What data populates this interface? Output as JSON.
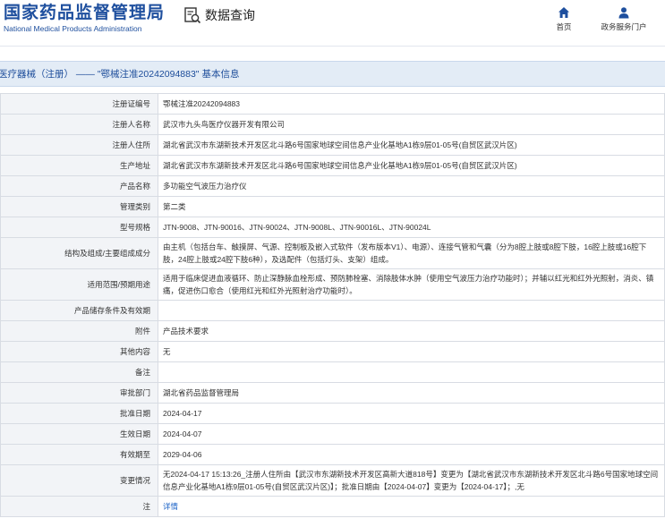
{
  "header": {
    "brand_cn": "国家药品监督管理局",
    "brand_en": "National Medical Products Administration",
    "search_title": "数据查询",
    "nav": [
      {
        "label": "首页",
        "icon": "home-icon"
      },
      {
        "label": "政务服务门户",
        "icon": "user-icon"
      }
    ]
  },
  "section": {
    "title": "医疗器械（注册） —— \"鄂械注准20242094883\" 基本信息"
  },
  "rows": [
    {
      "key": "注册证编号",
      "value": "鄂械注准20242094883"
    },
    {
      "key": "注册人名称",
      "value": "武汉市九头鸟医疗仪器开发有限公司"
    },
    {
      "key": "注册人住所",
      "value": "湖北省武汉市东湖新技术开发区北斗路6号国家地球空间信息产业化基地A1栋9层01-05号(自贸区武汉片区)"
    },
    {
      "key": "生产地址",
      "value": "湖北省武汉市东湖新技术开发区北斗路6号国家地球空间信息产业化基地A1栋9层01-05号(自贸区武汉片区)"
    },
    {
      "key": "产品名称",
      "value": "多功能空气波压力治疗仪"
    },
    {
      "key": "管理类别",
      "value": "第二类"
    },
    {
      "key": "型号规格",
      "value": "JTN-9008、JTN-90016、JTN-90024、JTN-9008L、JTN-90016L、JTN-90024L"
    },
    {
      "key": "结构及组成/主要组成成分",
      "value": "由主机（包括台车、触摸屏、气源、控制板及嵌入式软件（发布版本V1）、电源）、连接气管和气囊（分为8腔上肢或8腔下肢，16腔上肢或16腔下肢，24腔上肢或24腔下肢6种），及选配件（包括灯头、支架）组成。"
    },
    {
      "key": "适用范围/预期用途",
      "value": "适用于临床促进血液循环、防止深静脉血栓形成、预防肺栓塞、消除肢体水肿（使用空气波压力治疗功能时）；并辅以红光和红外光照射，消炎、镇痛，促进伤口愈合（使用红光和红外光照射治疗功能时）。"
    },
    {
      "key": "产品储存条件及有效期",
      "value": ""
    },
    {
      "key": "附件",
      "value": "产品技术要求"
    },
    {
      "key": "其他内容",
      "value": "无"
    },
    {
      "key": "备注",
      "value": ""
    },
    {
      "key": "审批部门",
      "value": "湖北省药品监督管理局"
    },
    {
      "key": "批准日期",
      "value": "2024-04-17"
    },
    {
      "key": "生效日期",
      "value": "2024-04-07"
    },
    {
      "key": "有效期至",
      "value": "2029-04-06"
    },
    {
      "key": "变更情况",
      "value": "无2024-04-17 15:13:26_注册人住所由【武汉市东湖新技术开发区高新大道818号】变更为【湖北省武汉市东湖新技术开发区北斗路6号国家地球空间信息产业化基地A1栋9层01-05号(自贸区武汉片区)】；批准日期由【2024-04-07】变更为【2024-04-17】；,无"
    },
    {
      "key": "注",
      "value": "详情"
    }
  ]
}
